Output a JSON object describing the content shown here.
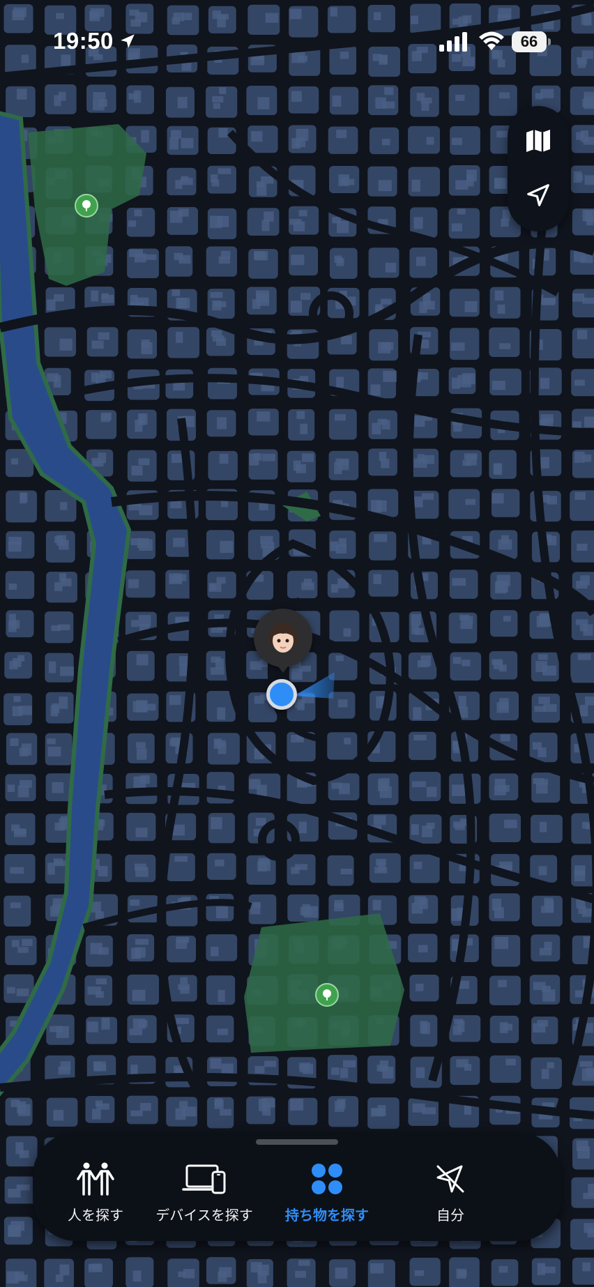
{
  "status_bar": {
    "time": "19:50",
    "battery": "66",
    "location_icon": "location-arrow-icon",
    "signal_icon": "cellular-signal-icon",
    "wifi_icon": "wifi-icon"
  },
  "map": {
    "style": "dark satellite-style street map",
    "colors": {
      "road": "#10141d",
      "block": "#344665",
      "park": "#2f6b47",
      "water": "#2a4b8a",
      "accent": "#2f8df7"
    }
  },
  "map_controls": {
    "items": [
      {
        "icon": "map-icon"
      },
      {
        "icon": "location-arrow-outline-icon"
      }
    ]
  },
  "markers": {
    "person_avatar": {
      "icon": "memoji-avatar-icon"
    },
    "current_location": {
      "icon": "blue-location-dot"
    },
    "parks": [
      {
        "icon": "tree-icon"
      },
      {
        "icon": "tree-icon"
      }
    ]
  },
  "tab_bar": {
    "tabs": [
      {
        "label": "人を探す",
        "icon": "people-icon",
        "active": false
      },
      {
        "label": "デバイスを探す",
        "icon": "devices-icon",
        "active": false
      },
      {
        "label": "持ち物を探す",
        "icon": "items-grid-icon",
        "active": true
      },
      {
        "label": "自分",
        "icon": "location-slash-icon",
        "active": false
      }
    ],
    "active_color": "#2f8df7"
  }
}
